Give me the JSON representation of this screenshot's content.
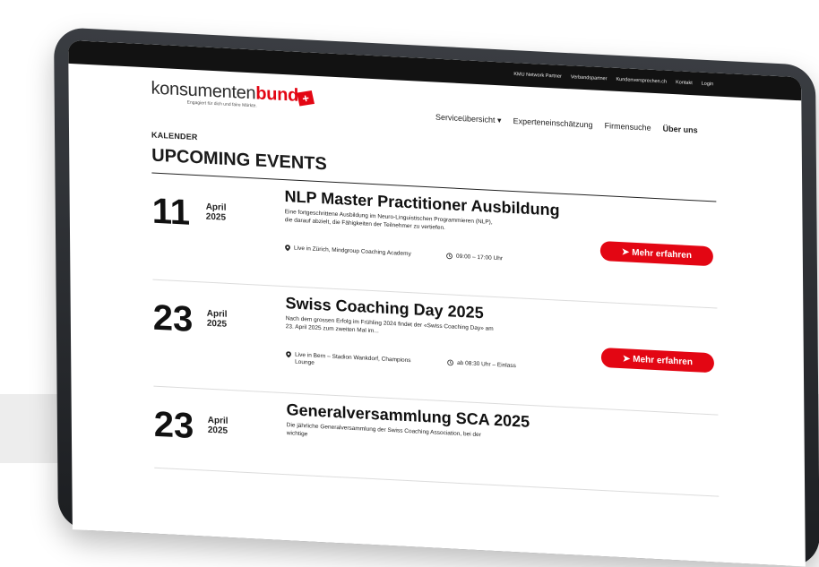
{
  "topnav": [
    "KMU Network Partner",
    "Verbandspartner",
    "Kundenversprechen.ch",
    "Kontakt",
    "Login"
  ],
  "brand": {
    "name_regular": "konsumenten",
    "name_bold": "bund",
    "tagline": "Engagiert für dich und faire Märkte.",
    "flag_symbol": "+"
  },
  "mainnav": [
    "Serviceübersicht",
    "Experteneinschätzung",
    "Firmensuche",
    "Über uns"
  ],
  "page": {
    "kicker": "KALENDER",
    "title": "UPCOMING EVENTS"
  },
  "button_label": "Mehr erfahren",
  "events": [
    {
      "day": "11",
      "month": "April",
      "year": "2025",
      "title": "NLP Master Practitioner Ausbildung",
      "description": "Eine fortgeschrittene Ausbildung im Neuro-Linguistischen Programmieren (NLP), die darauf abzielt, die Fähigkeiten der Teilnehmer zu vertiefen.",
      "location": "Live in Zürich, Mindgroup Coaching Academy",
      "time": "09:00 – 17:00 Uhr"
    },
    {
      "day": "23",
      "month": "April",
      "year": "2025",
      "title": "Swiss Coaching Day 2025",
      "description": "Nach dem grossen Erfolg im Frühling 2024 findet der «Swiss Coaching Day» am 23. April 2025 zum zweiten Mal im...",
      "location": "Live in Bern – Stadion Wankdorf, Champions Lounge",
      "time": "ab 08:30 Uhr – Einlass"
    },
    {
      "day": "23",
      "month": "April",
      "year": "2025",
      "title": "Generalversammlung SCA 2025",
      "description": "Die jährliche Generalversammlung der Swiss Coaching Association, bei der wichtige",
      "location": "",
      "time": ""
    }
  ],
  "colors": {
    "accent": "#e30613",
    "topbar": "#121212",
    "frame": "#2a2c30"
  }
}
